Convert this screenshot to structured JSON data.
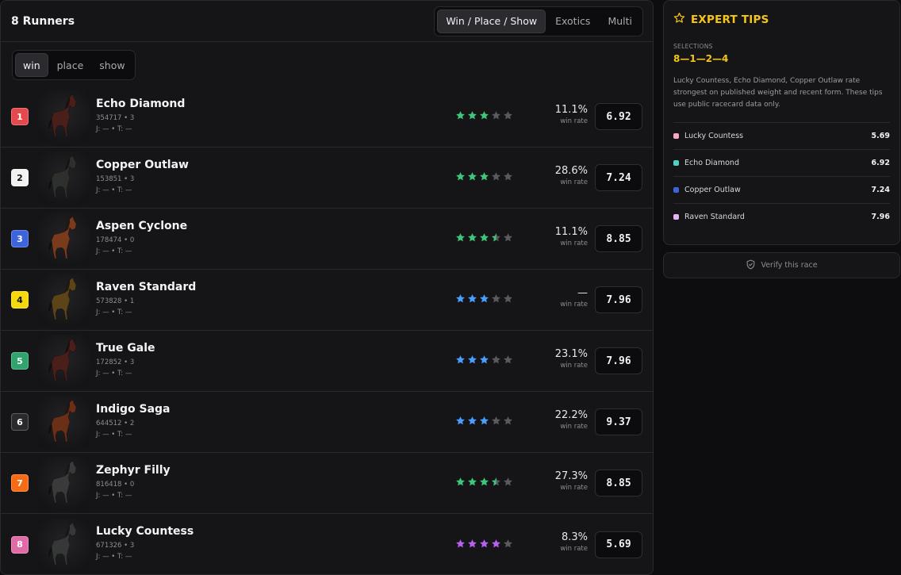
{
  "header": {
    "title": "8 Runners"
  },
  "bet_tabs": [
    "Win / Place / Show",
    "Exotics",
    "Multi"
  ],
  "sub_tabs": [
    "win",
    "place",
    "show"
  ],
  "win_label": "win rate",
  "runners": [
    {
      "number": "1",
      "name": "Echo Diamond",
      "meta": "354717 • 3",
      "jt": "J: — • T: —",
      "win_rate": "11.1%",
      "odds": "6.92",
      "stars": 3,
      "half": false,
      "star_color": "#3ec77a",
      "badge_color": "#e5484d",
      "coat": "#4a1f1a"
    },
    {
      "number": "2",
      "name": "Copper Outlaw",
      "meta": "153851 • 3",
      "jt": "J: — • T: —",
      "win_rate": "28.6%",
      "odds": "7.24",
      "stars": 3,
      "half": false,
      "star_color": "#3ec77a",
      "badge_color": "#f2f2f2",
      "coat": "#2d302c"
    },
    {
      "number": "3",
      "name": "Aspen Cyclone",
      "meta": "178474 • 0",
      "jt": "J: — • T: —",
      "win_rate": "11.1%",
      "odds": "8.85",
      "stars": 3,
      "half": true,
      "star_color": "#3ec77a",
      "badge_color": "#3d63dd",
      "coat": "#7a3a1c"
    },
    {
      "number": "4",
      "name": "Raven Standard",
      "meta": "573828 • 1",
      "jt": "J: — • T: —",
      "win_rate": "—",
      "odds": "7.96",
      "stars": 3,
      "half": false,
      "star_color": "#4a9eff",
      "badge_color": "#f5d90a",
      "coat": "#5c4318"
    },
    {
      "number": "5",
      "name": "True Gale",
      "meta": "172852 • 3",
      "jt": "J: — • T: —",
      "win_rate": "23.1%",
      "odds": "7.96",
      "stars": 3,
      "half": false,
      "star_color": "#4a9eff",
      "badge_color": "#30a46c",
      "coat": "#4a1f1a"
    },
    {
      "number": "6",
      "name": "Indigo Saga",
      "meta": "644512 • 2",
      "jt": "J: — • T: —",
      "win_rate": "22.2%",
      "odds": "9.37",
      "stars": 3,
      "half": false,
      "star_color": "#4a9eff",
      "badge_color": "#2a2a2d",
      "coat": "#6b2e17"
    },
    {
      "number": "7",
      "name": "Zephyr Filly",
      "meta": "816418 • 0",
      "jt": "J: — • T: —",
      "win_rate": "27.3%",
      "odds": "8.85",
      "stars": 3,
      "half": true,
      "star_color": "#3ec77a",
      "badge_color": "#f76b15",
      "coat": "#3a3a3a"
    },
    {
      "number": "8",
      "name": "Lucky Countess",
      "meta": "671326 • 3",
      "jt": "J: — • T: —",
      "win_rate": "8.3%",
      "odds": "5.69",
      "stars": 4,
      "half": false,
      "star_color": "#b560f0",
      "badge_color": "#e06ba7",
      "coat": "#363838"
    }
  ],
  "expert_tips": {
    "title": "EXPERT TIPS",
    "selections_label": "SELECTIONS",
    "selections": "8—1—2—4",
    "text": "Lucky Countess, Echo Diamond, Copper Outlaw rate strongest on published weight and recent form. These tips use public racecard data only.",
    "picks": [
      {
        "name": "Lucky Countess",
        "odds": "5.69",
        "color": "#f4a7c0"
      },
      {
        "name": "Echo Diamond",
        "odds": "6.92",
        "color": "#4fd1c5"
      },
      {
        "name": "Copper Outlaw",
        "odds": "7.24",
        "color": "#3d63dd"
      },
      {
        "name": "Raven Standard",
        "odds": "7.96",
        "color": "#e5b3f5"
      }
    ]
  },
  "verify": {
    "label": "Verify this race"
  }
}
